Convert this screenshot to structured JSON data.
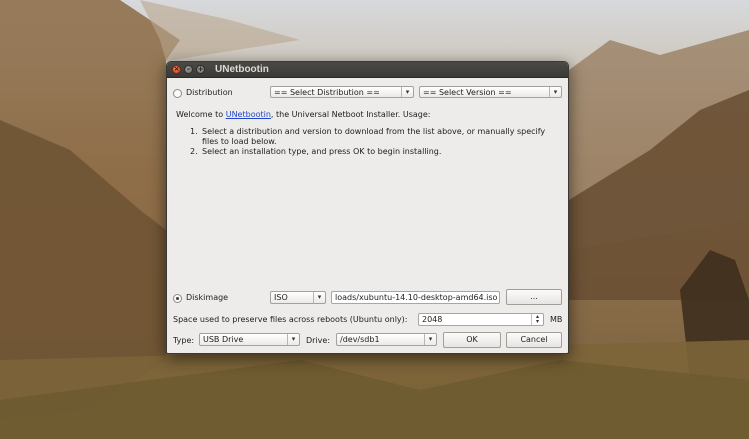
{
  "window": {
    "title": "UNetbootin",
    "close_glyph": "×",
    "min_glyph": "–",
    "max_glyph": "+"
  },
  "distribution": {
    "radio_label": "Distribution",
    "radio_selected": false,
    "distribution_select": "== Select Distribution ==",
    "version_select": "== Select Version =="
  },
  "welcome": {
    "prefix": "Welcome to ",
    "link": "UNetbootin",
    "suffix": ", the Universal Netboot Installer. Usage:"
  },
  "steps": [
    {
      "num": "1.",
      "text": "Select a distribution and version to download from the list above, or manually specify files to load below."
    },
    {
      "num": "2.",
      "text": "Select an installation type, and press OK to begin installing."
    }
  ],
  "diskimage": {
    "radio_label": "Diskimage",
    "radio_selected": true,
    "type_select": "ISO",
    "path_value": "loads/xubuntu-14.10-desktop-amd64.iso",
    "browse_label": "..."
  },
  "persistence": {
    "label": "Space used to preserve files across reboots (Ubuntu only):",
    "value": "2048",
    "unit": "MB"
  },
  "bottom": {
    "type_label": "Type:",
    "type_value": "USB Drive",
    "drive_label": "Drive:",
    "drive_value": "/dev/sdb1",
    "ok_label": "OK",
    "cancel_label": "Cancel"
  },
  "icons": {
    "dropdown_arrow": "▾",
    "spin_up": "▴",
    "spin_down": "▾"
  }
}
